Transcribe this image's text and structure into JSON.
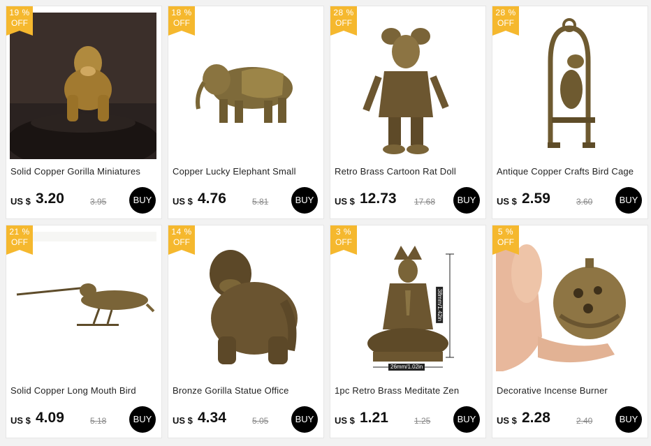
{
  "colors": {
    "badge": "#f5b82e",
    "buy_bg": "#000000",
    "card_bg": "#ffffff",
    "page_bg": "#f2f2f2"
  },
  "products": [
    {
      "discount": "19 %",
      "off": "OFF",
      "title": "Solid Copper Gorilla Miniatures",
      "currency": "US $",
      "price": "3.20",
      "old_price": "3.95",
      "buy": "BUY",
      "image": "brass gorilla figurine on dark background"
    },
    {
      "discount": "18 %",
      "off": "OFF",
      "title": "Copper Lucky Elephant Small",
      "currency": "US $",
      "price": "4.76",
      "old_price": "5.81",
      "buy": "BUY",
      "image": "brass elephant figurine"
    },
    {
      "discount": "28 %",
      "off": "OFF",
      "title": "Retro Brass Cartoon Rat Doll",
      "currency": "US $",
      "price": "12.73",
      "old_price": "17.68",
      "buy": "BUY",
      "image": "brass rat doll in jacket"
    },
    {
      "discount": "28 %",
      "off": "OFF",
      "title": "Antique Copper Crafts Bird Cage",
      "currency": "US $",
      "price": "2.59",
      "old_price": "3.60",
      "buy": "BUY",
      "image": "brass parrot on swing"
    },
    {
      "discount": "21 %",
      "off": "OFF",
      "title": "Solid Copper Long Mouth Bird",
      "currency": "US $",
      "price": "4.09",
      "old_price": "5.18",
      "buy": "BUY",
      "image": "brass long beak bird"
    },
    {
      "discount": "14 %",
      "off": "OFF",
      "title": "Bronze Gorilla Statue Office",
      "currency": "US $",
      "price": "4.34",
      "old_price": "5.05",
      "buy": "BUY",
      "image": "bronze gorilla statue"
    },
    {
      "discount": "3 %",
      "off": "OFF",
      "title": "1pc Retro Brass Meditate Zen",
      "currency": "US $",
      "price": "1.21",
      "old_price": "1.25",
      "buy": "BUY",
      "image": "brass meditating buddha with dimensions",
      "dim_w": "26mm/1.02in",
      "dim_h": "38mm/1.42in"
    },
    {
      "discount": "5 %",
      "off": "OFF",
      "title": "Decorative Incense Burner",
      "currency": "US $",
      "price": "2.28",
      "old_price": "2.40",
      "buy": "BUY",
      "image": "hand holding brass lotus incense burner"
    }
  ]
}
